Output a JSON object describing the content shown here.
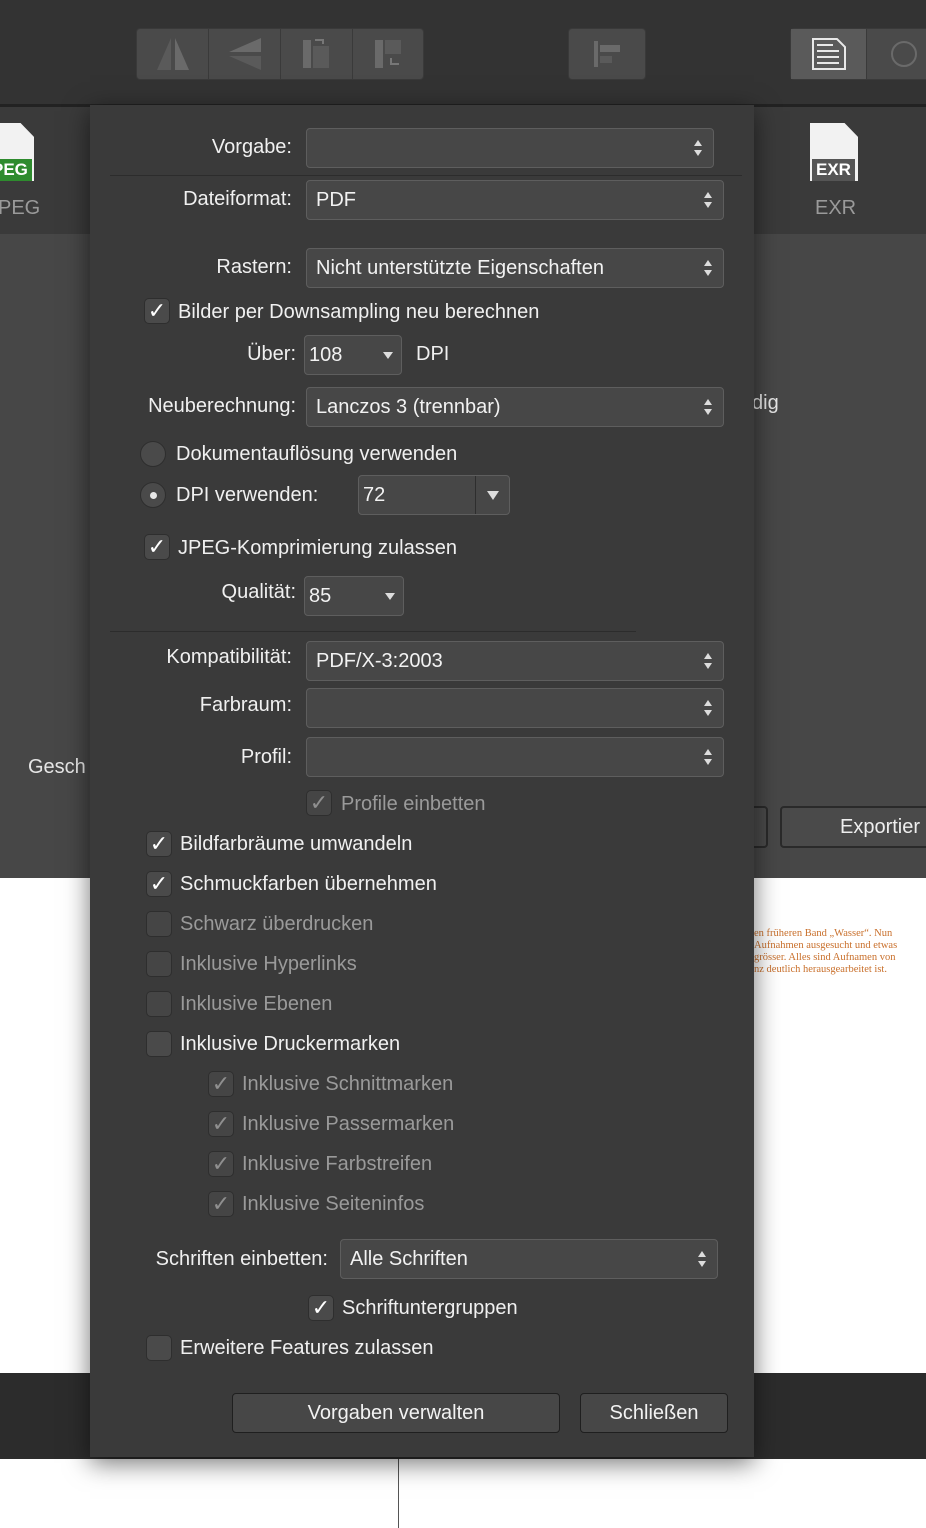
{
  "background": {
    "format_icons": [
      {
        "tag": "PEG",
        "label": "PEG",
        "tag_color": "#2e8b2e"
      },
      {
        "tag": "EXR",
        "label": "EXR",
        "tag_color": "#555555"
      }
    ],
    "partial_text_right": "dig",
    "partial_text_left": "Gesch",
    "export_button_label": "Exportier",
    "document_snippet": [
      "en früheren Band „Wasser“. Nun",
      "Aufnahmen ausgesucht und etwas",
      " grösser. Alles sind Aufnamen von",
      "nz deutlich herausgearbeitet ist."
    ]
  },
  "dialog": {
    "preset": {
      "label": "Vorgabe:",
      "value": ""
    },
    "file_format": {
      "label": "Dateiformat:",
      "value": "PDF"
    },
    "rasterize": {
      "label": "Rastern:",
      "value": "Nicht unterstützte Eigenschaften"
    },
    "downsample": {
      "label": "Bilder per Downsampling neu berechnen",
      "checked": true
    },
    "over": {
      "label": "Über:",
      "value": "108",
      "unit": "DPI"
    },
    "resample": {
      "label": "Neuberechnung:",
      "value": "Lanczos 3 (trennbar)"
    },
    "use_doc_resolution": {
      "label": "Dokumentauflösung verwenden",
      "selected": false
    },
    "use_dpi": {
      "label": "DPI verwenden:",
      "selected": true,
      "value": "72"
    },
    "jpeg_compression": {
      "label": "JPEG-Komprimierung zulassen",
      "checked": true
    },
    "quality": {
      "label": "Qualität:",
      "value": "85"
    },
    "compatibility": {
      "label": "Kompatibilität:",
      "value": "PDF/X-3:2003"
    },
    "color_space": {
      "label": "Farbraum:",
      "value": ""
    },
    "profile": {
      "label": "Profil:",
      "value": ""
    },
    "embed_profiles": {
      "label": "Profile einbetten",
      "checked": true,
      "enabled": false
    },
    "convert_image_colorspaces": {
      "label": "Bildfarbräume umwandeln",
      "checked": true
    },
    "spot_colors": {
      "label": "Schmuckfarben übernehmen",
      "checked": true
    },
    "overprint_black": {
      "label": "Schwarz überdrucken",
      "checked": false,
      "enabled": false
    },
    "include_hyperlinks": {
      "label": "Inklusive Hyperlinks",
      "checked": false,
      "enabled": false
    },
    "include_layers": {
      "label": "Inklusive Ebenen",
      "checked": false,
      "enabled": false
    },
    "include_printer_marks": {
      "label": "Inklusive Druckermarken",
      "checked": false
    },
    "crop_marks": {
      "label": "Inklusive Schnittmarken",
      "checked": true,
      "enabled": false
    },
    "registration_marks": {
      "label": "Inklusive Passermarken",
      "checked": true,
      "enabled": false
    },
    "color_bars": {
      "label": "Inklusive Farbstreifen",
      "checked": true,
      "enabled": false
    },
    "page_info": {
      "label": "Inklusive Seiteninfos",
      "checked": true,
      "enabled": false
    },
    "embed_fonts": {
      "label": "Schriften einbetten:",
      "value": "Alle Schriften"
    },
    "font_subsets": {
      "label": "Schriftuntergruppen",
      "checked": true
    },
    "advanced_features": {
      "label": "Erweitere Features zulassen",
      "checked": false
    },
    "manage_presets_button": "Vorgaben verwalten",
    "close_button": "Schließen"
  }
}
